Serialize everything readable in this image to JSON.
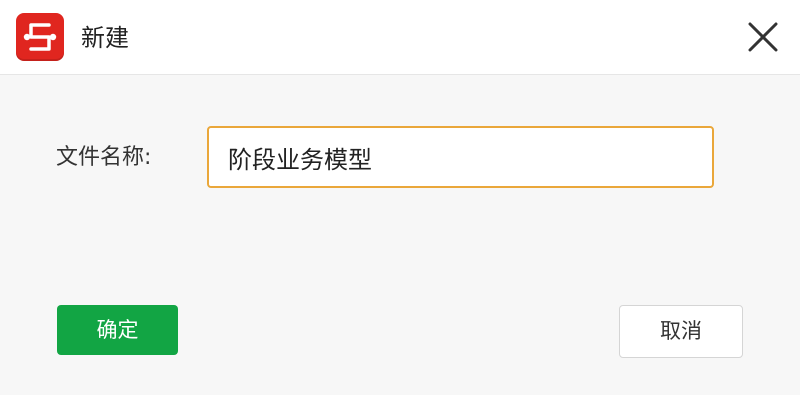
{
  "dialog": {
    "title": "新建",
    "app_icon": "app-logo-icon",
    "close_icon": "close-icon"
  },
  "form": {
    "file_name_label": "文件名称:",
    "file_name_value": "阶段业务模型"
  },
  "buttons": {
    "confirm_label": "确定",
    "cancel_label": "取消"
  },
  "colors": {
    "logo_red": "#e0261f",
    "confirm_green": "#12a544",
    "input_focus_border": "#eaa73a"
  }
}
